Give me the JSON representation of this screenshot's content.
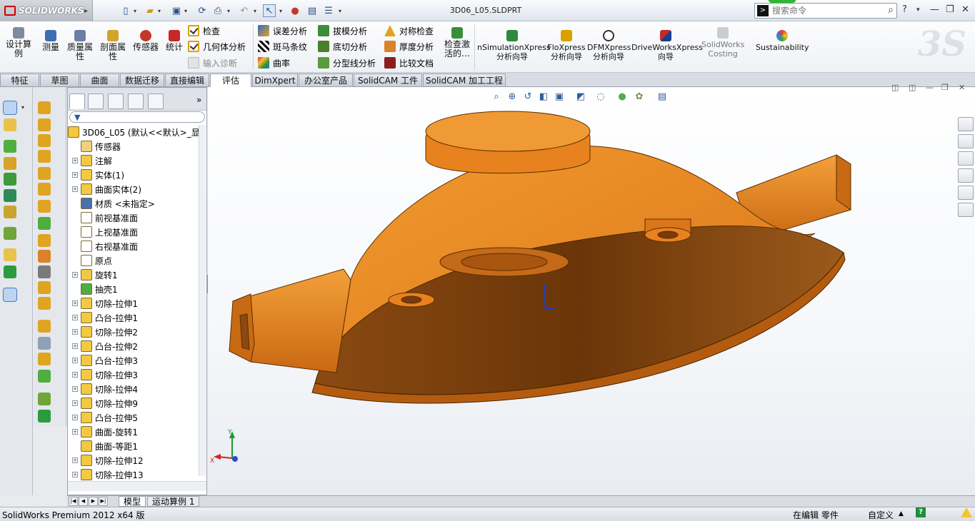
{
  "app": {
    "name": "SOLIDWORKS",
    "doc_title": "3D06_L05.SLDPRT",
    "brand_color": "#c8102e"
  },
  "search": {
    "placeholder": "搜索命令"
  },
  "ribbon": {
    "design_study": "设计算例",
    "measure": "测量",
    "mass_properties": "质量属性",
    "section_properties": "剖面属性",
    "sensor": "传感器",
    "statistics": "统计",
    "check": "检查",
    "geometry_analysis": "几何体分析",
    "import_diagnostics": "输入诊断",
    "deviation_analysis": "误差分析",
    "zebra_stripes": "斑马条纹",
    "curvature": "曲率",
    "draft_analysis": "拔模分析",
    "undercut_analysis": "底切分析",
    "parting_line_analysis": "分型线分析",
    "symmetry_check": "对称检查",
    "thickness_analysis": "厚度分析",
    "compare_documents": "比较文档",
    "check_active": "检查激活的…",
    "simulationxpress": "nSimulationXpress分析向导",
    "floxpress": "FloXpress分析向导",
    "dfmxpress": "DFMXpress分析向导",
    "driveworksxpress": "DriveWorksXpress向导",
    "costing": "SolidWorks Costing",
    "sustainability": "Sustainability"
  },
  "tabs": [
    "特征",
    "草图",
    "曲面",
    "数据迁移",
    "直接编辑",
    "评估",
    "DimXpert",
    "办公室产品",
    "SolidCAM 工件",
    "SolidCAM 加工工程"
  ],
  "active_tab": "评估",
  "tree": {
    "root": "3D06_L05 (默认<<默认>_显",
    "items": [
      {
        "label": "传感器",
        "icon": "sensor-icon",
        "expandable": false
      },
      {
        "label": "注解",
        "icon": "annotation-icon",
        "expandable": true
      },
      {
        "label": "实体(1)",
        "icon": "solid-bodies-icon",
        "expandable": true
      },
      {
        "label": "曲面实体(2)",
        "icon": "surface-bodies-icon",
        "expandable": true
      },
      {
        "label": "材质 <未指定>",
        "icon": "material-icon",
        "expandable": false
      },
      {
        "label": "前视基准面",
        "icon": "plane-icon",
        "expandable": false
      },
      {
        "label": "上视基准面",
        "icon": "plane-icon",
        "expandable": false
      },
      {
        "label": "右视基准面",
        "icon": "plane-icon",
        "expandable": false
      },
      {
        "label": "原点",
        "icon": "origin-icon",
        "expandable": false
      },
      {
        "label": "旋转1",
        "icon": "revolve-icon",
        "expandable": true
      },
      {
        "label": "抽壳1",
        "icon": "shell-icon",
        "expandable": false
      },
      {
        "label": "切除-拉伸1",
        "icon": "cut-extrude-icon",
        "expandable": true
      },
      {
        "label": "凸台-拉伸1",
        "icon": "boss-extrude-icon",
        "expandable": true
      },
      {
        "label": "切除-拉伸2",
        "icon": "cut-extrude-icon",
        "expandable": true
      },
      {
        "label": "凸台-拉伸2",
        "icon": "boss-extrude-icon",
        "expandable": true
      },
      {
        "label": "凸台-拉伸3",
        "icon": "boss-extrude-icon",
        "expandable": true
      },
      {
        "label": "切除-拉伸3",
        "icon": "cut-extrude-icon",
        "expandable": true
      },
      {
        "label": "切除-拉伸4",
        "icon": "cut-extrude-icon",
        "expandable": true
      },
      {
        "label": "切除-拉伸9",
        "icon": "cut-extrude-icon",
        "expandable": true
      },
      {
        "label": "凸台-拉伸5",
        "icon": "boss-extrude-icon",
        "expandable": true
      },
      {
        "label": "曲面-旋转1",
        "icon": "surface-revolve-icon",
        "expandable": true
      },
      {
        "label": "曲面-等距1",
        "icon": "surface-offset-icon",
        "expandable": false
      },
      {
        "label": "切除-拉伸12",
        "icon": "cut-extrude-icon",
        "expandable": true
      },
      {
        "label": "切除-拉伸13",
        "icon": "cut-extrude-icon",
        "expandable": true
      }
    ]
  },
  "bottom_tabs": [
    "模型",
    "运动算例 1"
  ],
  "triad": {
    "x": "X",
    "y": "Y"
  },
  "status": {
    "version": "SolidWorks Premium 2012 x64 版",
    "editing": "在编辑 零件",
    "units": "自定义"
  },
  "model_color": "#e8821e"
}
